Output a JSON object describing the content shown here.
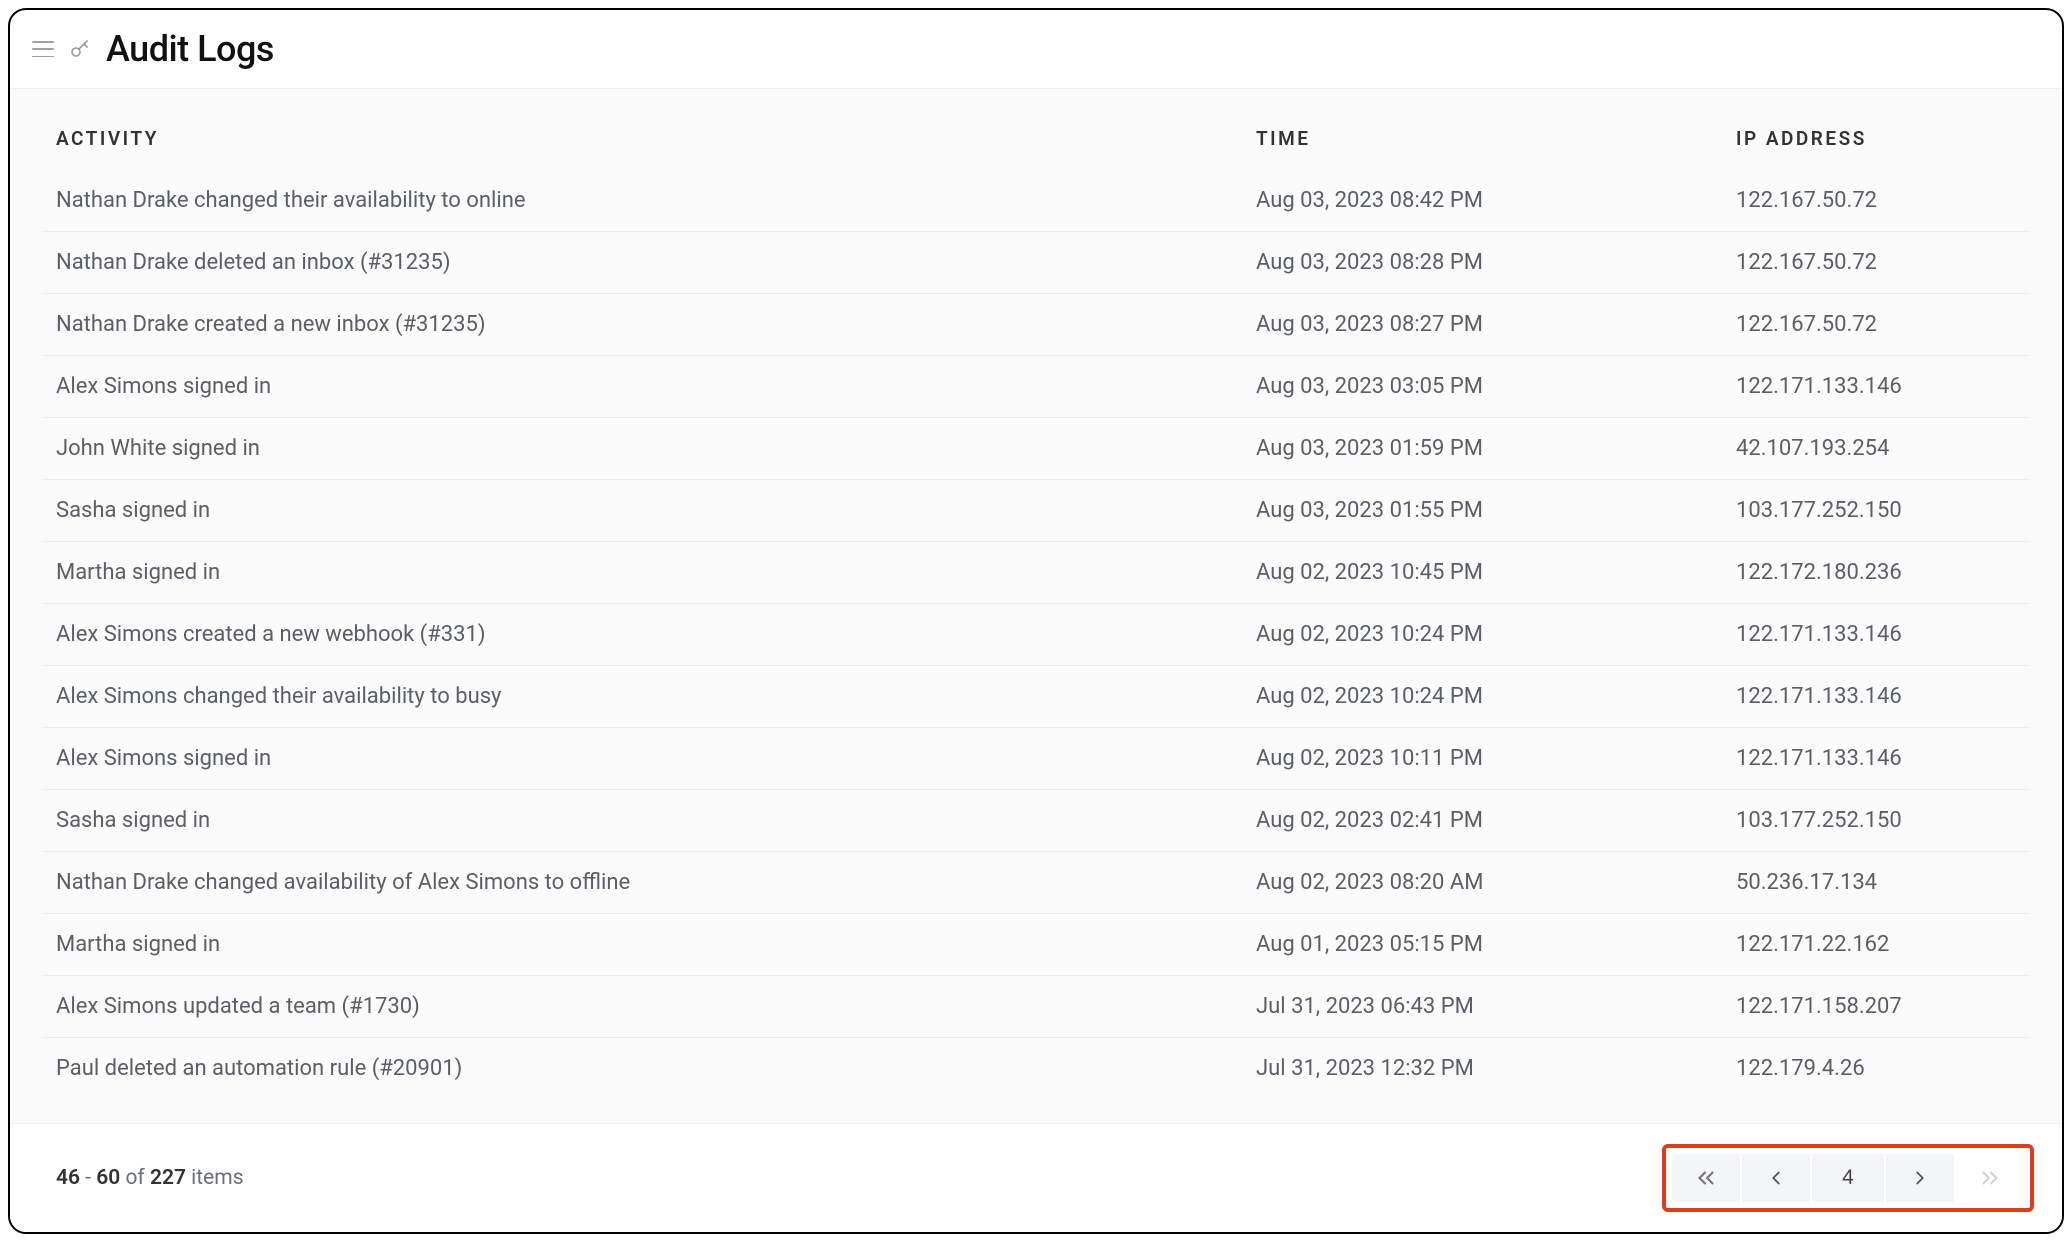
{
  "page": {
    "title": "Audit Logs"
  },
  "table": {
    "columns": {
      "activity": "ACTIVITY",
      "time": "TIME",
      "ip": "IP ADDRESS"
    },
    "rows": [
      {
        "activity": "Nathan Drake changed their availability to online",
        "time": "Aug 03, 2023 08:42 PM",
        "ip": "122.167.50.72"
      },
      {
        "activity": "Nathan Drake deleted an inbox (#31235)",
        "time": "Aug 03, 2023 08:28 PM",
        "ip": "122.167.50.72"
      },
      {
        "activity": "Nathan Drake created a new inbox (#31235)",
        "time": "Aug 03, 2023 08:27 PM",
        "ip": "122.167.50.72"
      },
      {
        "activity": "Alex Simons signed in",
        "time": "Aug 03, 2023 03:05 PM",
        "ip": "122.171.133.146"
      },
      {
        "activity": "John White signed in",
        "time": "Aug 03, 2023 01:59 PM",
        "ip": "42.107.193.254"
      },
      {
        "activity": "Sasha signed in",
        "time": "Aug 03, 2023 01:55 PM",
        "ip": "103.177.252.150"
      },
      {
        "activity": "Martha signed in",
        "time": "Aug 02, 2023 10:45 PM",
        "ip": "122.172.180.236"
      },
      {
        "activity": "Alex Simons created a new webhook (#331)",
        "time": "Aug 02, 2023 10:24 PM",
        "ip": "122.171.133.146"
      },
      {
        "activity": "Alex Simons changed their availability to busy",
        "time": "Aug 02, 2023 10:24 PM",
        "ip": "122.171.133.146"
      },
      {
        "activity": "Alex Simons signed in",
        "time": "Aug 02, 2023 10:11 PM",
        "ip": "122.171.133.146"
      },
      {
        "activity": "Sasha signed in",
        "time": "Aug 02, 2023 02:41 PM",
        "ip": "103.177.252.150"
      },
      {
        "activity": "Nathan Drake changed availability of Alex Simons to offline",
        "time": "Aug 02, 2023 08:20 AM",
        "ip": "50.236.17.134"
      },
      {
        "activity": "Martha signed in",
        "time": "Aug 01, 2023 05:15 PM",
        "ip": "122.171.22.162"
      },
      {
        "activity": "Alex Simons updated a team (#1730)",
        "time": "Jul 31, 2023 06:43 PM",
        "ip": "122.171.158.207"
      },
      {
        "activity": "Paul deleted an automation rule (#20901)",
        "time": "Jul 31, 2023 12:32 PM",
        "ip": "122.179.4.26"
      }
    ]
  },
  "pagination": {
    "range_start": "46",
    "range_end": "60",
    "of_label": "of",
    "total": "227",
    "items_label": "items",
    "dash": " - ",
    "current_page": "4"
  }
}
